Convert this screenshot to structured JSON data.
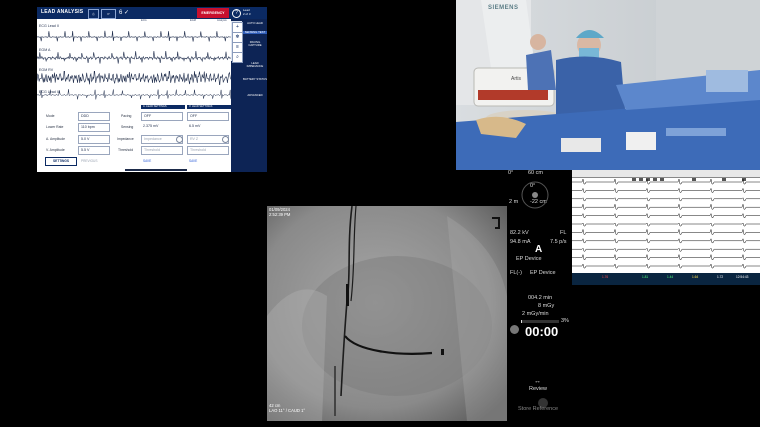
{
  "programmer": {
    "title": "LEAD ANALYSIS",
    "emergency_label": "EMERGENCY",
    "header_icon_1": "P",
    "header_icon_2": "2",
    "header_status": "6 ✓",
    "header_right_lines": [
      "Lead",
      "2 of 3"
    ],
    "column_heads": [
      "ECG",
      "EGM",
      "Analysis"
    ],
    "traces": [
      {
        "label": "ECG Lead II"
      },
      {
        "label": "EGM A"
      },
      {
        "label": "EGM RV"
      },
      {
        "label": "ECG Lead III"
      }
    ],
    "right_menu": [
      {
        "label": "AUTO LEAD",
        "active": false
      },
      {
        "label": "SENSING TEST",
        "active": true
      },
      {
        "label": "PACING CAPTURE",
        "active": false
      },
      {
        "label": "LEAD IMPEDANCE",
        "active": false
      },
      {
        "label": "BATTERY STATUS",
        "active": false
      },
      {
        "label": "ADVANCED",
        "active": false
      }
    ],
    "settings": {
      "mode_label": "Mode",
      "mode_value": "DDD",
      "lower_rate_label": "Lower Rate",
      "lower_rate_value": "110 bpm",
      "a_amp_label": "A. Amplitude",
      "a_amp_value": "5.0 V",
      "v_amp_label": "V. Amplitude",
      "v_amp_value": "5.5 V",
      "settings_button": "SETTINGS",
      "more_label": "PREVIOUS",
      "col_a_head": "A. LEAD SETTINGS",
      "col_v_head": "V. LEAD SETTINGS",
      "pacing_label": "Pacing",
      "pacing_a": "OFF",
      "pacing_v": "OFF",
      "sensing_label": "Sensing",
      "sensing_a": "2.375 mV",
      "sensing_v": "6.5 mV",
      "impedance_label": "Impedance",
      "impedance_a": "Impedance",
      "impedance_v": "RV Z",
      "threshold_label": "Threshold",
      "threshold_a": "Threshold",
      "threshold_v": "Threshold",
      "save_a": "SAVE",
      "save_v": "SAVE"
    }
  },
  "photo": {
    "brand": "SIEMENS",
    "model": "Artis"
  },
  "fluoro": {
    "date": "01/09/2024",
    "time": "2:52:39 PM",
    "frame": "1",
    "size_label": "42 cm",
    "angle_label": "LAO 11° / CAUD 1°"
  },
  "dose": {
    "angle_top": "0°",
    "angle_top_sub": "60 cm",
    "angle_mid": "0°",
    "angle_left": "2 m",
    "angle_right": "-22 cm",
    "kv": "82.2 kV",
    "fl": "FL",
    "ma": "94.8 mA",
    "pps": "7.5 p/s",
    "mode_letter": "A",
    "ep_device_1": "EP Device",
    "ep_device_2": "EP Device",
    "fl_label": "FL(-)",
    "fluoro_time": "004.2 min",
    "dose_mgy": "8 mGy",
    "rate": "2 mGy/min",
    "percent": "3%",
    "timer": "00:00",
    "review_label": "Review",
    "store_label": "Store Reference"
  },
  "ecg_monitor": {
    "bottom_values": [
      "1.76",
      "1.81",
      "1.44",
      "1.64",
      "1.72",
      "12:54:43"
    ]
  },
  "colors": {
    "programmer_header": "#0b2a63",
    "emergency": "#c8102e",
    "drape_blue": "#3d6bb8"
  }
}
